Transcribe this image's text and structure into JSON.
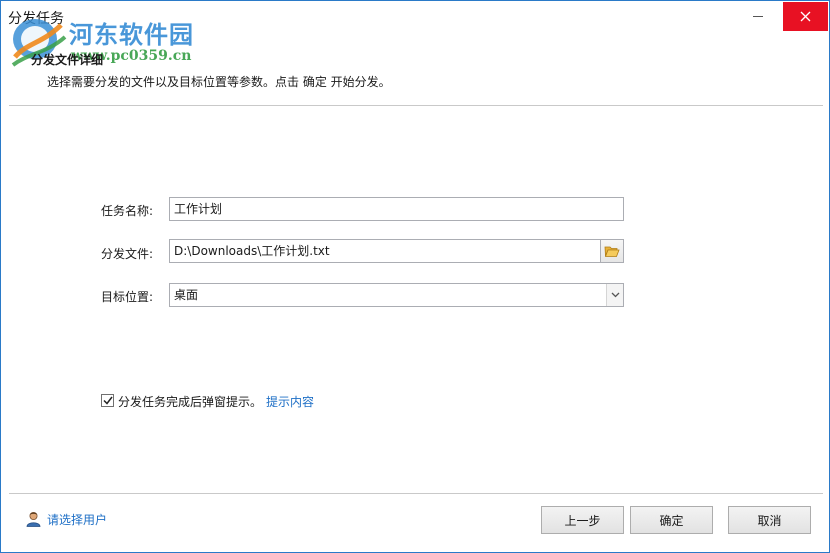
{
  "window": {
    "title": "分发任务"
  },
  "watermark": {
    "site_name": "河东软件园",
    "site_url": "www.pc0359.cn"
  },
  "header": {
    "title": "分发文件详细",
    "description": "选择需要分发的文件以及目标位置等参数。点击 确定 开始分发。"
  },
  "form": {
    "task_name_label": "任务名称:",
    "task_name_value": "工作计划",
    "file_label": "分发文件:",
    "file_value": "D:\\Downloads\\工作计划.txt",
    "target_label": "目标位置:",
    "target_value": "桌面"
  },
  "options": {
    "popup_checkbox_label": "分发任务完成后弹窗提示。",
    "popup_checked": true,
    "prompt_link": "提示内容"
  },
  "footer": {
    "select_user_link": "请选择用户",
    "prev_button": "上一步",
    "ok_button": "确定",
    "cancel_button": "取消"
  },
  "icons": {
    "browse": "folder-open-icon",
    "dropdown": "chevron-down-icon",
    "user": "user-icon",
    "close": "close-icon",
    "minimize": "minimize-icon"
  },
  "colors": {
    "window_border": "#2a7ac8",
    "close_button": "#e81123",
    "link": "#1e6fc6",
    "separator": "#c9c9c9"
  }
}
